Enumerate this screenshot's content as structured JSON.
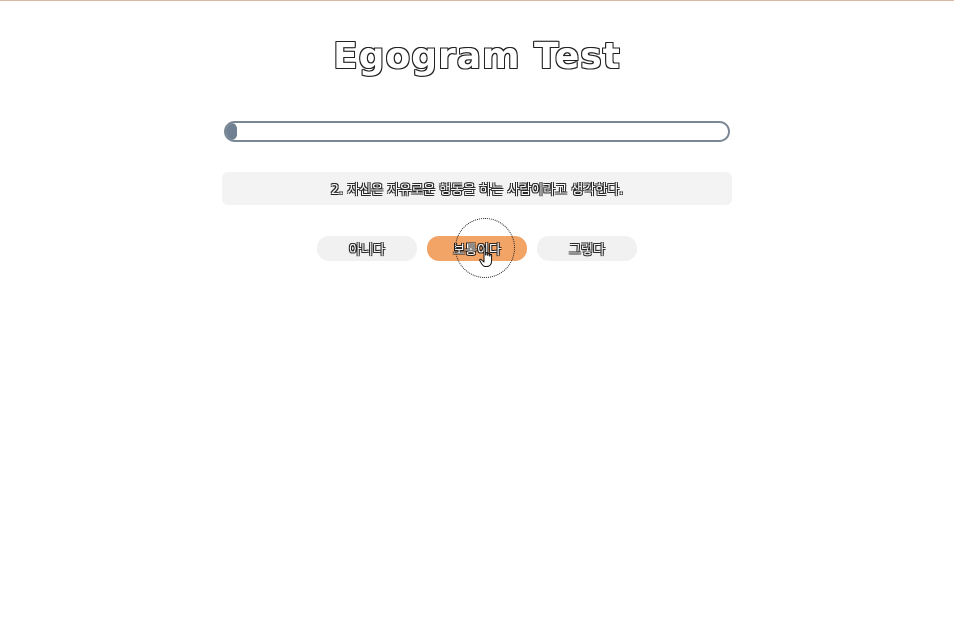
{
  "title": "Egogram Test",
  "progress": {
    "value_percent": 2,
    "fill_color": "#6f8192"
  },
  "question": {
    "text": "2. 자신은 자유로운 행동을 하는 사람이라고 생각한다."
  },
  "answers": [
    {
      "label": "아니다",
      "selected": false
    },
    {
      "label": "보통이다",
      "selected": true
    },
    {
      "label": "그렇다",
      "selected": false
    }
  ],
  "colors": {
    "selected_answer": "#f2a366",
    "answer_background": "#f1f1f1",
    "question_background": "#f3f3f3"
  },
  "cursor": {
    "icon": "hand-pointer-icon"
  }
}
